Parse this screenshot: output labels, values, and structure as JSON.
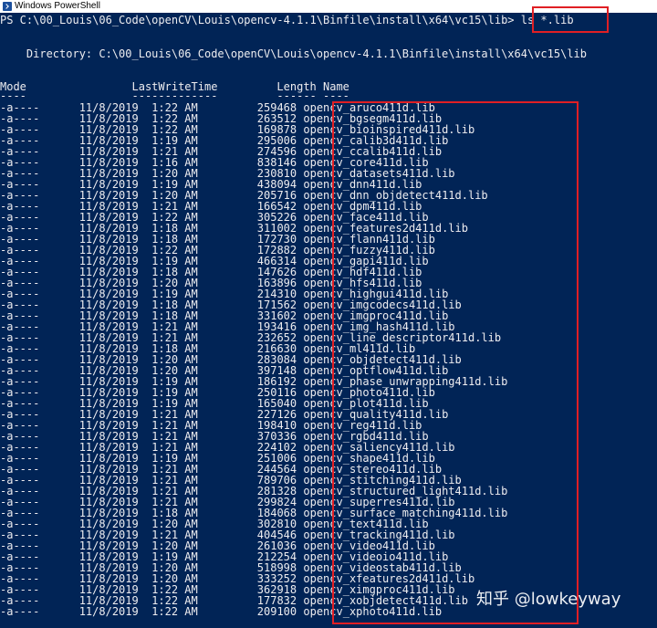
{
  "window": {
    "title": "Windows PowerShell"
  },
  "prompt": {
    "path": "PS C:\\00_Louis\\06_Code\\openCV\\Louis\\opencv-4.1.1\\Binfile\\install\\x64\\vc15\\lib> ",
    "command": "ls *.lib"
  },
  "directory_line": "    Directory: C:\\00_Louis\\06_Code\\openCV\\Louis\\opencv-4.1.1\\Binfile\\install\\x64\\vc15\\lib",
  "columns": {
    "header": "Mode                LastWriteTime         Length Name",
    "underline": "----                -------------         ------ ----"
  },
  "files": [
    [
      "-a----",
      "11/8/2019",
      " 1:22 AM",
      "259468",
      "opencv_aruco411d.lib"
    ],
    [
      "-a----",
      "11/8/2019",
      " 1:22 AM",
      "263512",
      "opencv_bgsegm411d.lib"
    ],
    [
      "-a----",
      "11/8/2019",
      " 1:22 AM",
      "169878",
      "opencv_bioinspired411d.lib"
    ],
    [
      "-a----",
      "11/8/2019",
      " 1:19 AM",
      "295006",
      "opencv_calib3d411d.lib"
    ],
    [
      "-a----",
      "11/8/2019",
      " 1:21 AM",
      "274596",
      "opencv_ccalib411d.lib"
    ],
    [
      "-a----",
      "11/8/2019",
      " 1:16 AM",
      "838146",
      "opencv_core411d.lib"
    ],
    [
      "-a----",
      "11/8/2019",
      " 1:20 AM",
      "230810",
      "opencv_datasets411d.lib"
    ],
    [
      "-a----",
      "11/8/2019",
      " 1:19 AM",
      "438094",
      "opencv_dnn411d.lib"
    ],
    [
      "-a----",
      "11/8/2019",
      " 1:20 AM",
      "205716",
      "opencv_dnn_objdetect411d.lib"
    ],
    [
      "-a----",
      "11/8/2019",
      " 1:21 AM",
      "166542",
      "opencv_dpm411d.lib"
    ],
    [
      "-a----",
      "11/8/2019",
      " 1:22 AM",
      "305226",
      "opencv_face411d.lib"
    ],
    [
      "-a----",
      "11/8/2019",
      " 1:18 AM",
      "311002",
      "opencv_features2d411d.lib"
    ],
    [
      "-a----",
      "11/8/2019",
      " 1:18 AM",
      "172730",
      "opencv_flann411d.lib"
    ],
    [
      "-a----",
      "11/8/2019",
      " 1:22 AM",
      "172882",
      "opencv_fuzzy411d.lib"
    ],
    [
      "-a----",
      "11/8/2019",
      " 1:19 AM",
      "466314",
      "opencv_gapi411d.lib"
    ],
    [
      "-a----",
      "11/8/2019",
      " 1:18 AM",
      "147626",
      "opencv_hdf411d.lib"
    ],
    [
      "-a----",
      "11/8/2019",
      " 1:20 AM",
      "163896",
      "opencv_hfs411d.lib"
    ],
    [
      "-a----",
      "11/8/2019",
      " 1:19 AM",
      "214310",
      "opencv_highgui411d.lib"
    ],
    [
      "-a----",
      "11/8/2019",
      " 1:18 AM",
      "171562",
      "opencv_imgcodecs411d.lib"
    ],
    [
      "-a----",
      "11/8/2019",
      " 1:18 AM",
      "331602",
      "opencv_imgproc411d.lib"
    ],
    [
      "-a----",
      "11/8/2019",
      " 1:21 AM",
      "193416",
      "opencv_img_hash411d.lib"
    ],
    [
      "-a----",
      "11/8/2019",
      " 1:21 AM",
      "232652",
      "opencv_line_descriptor411d.lib"
    ],
    [
      "-a----",
      "11/8/2019",
      " 1:18 AM",
      "216630",
      "opencv_ml411d.lib"
    ],
    [
      "-a----",
      "11/8/2019",
      " 1:20 AM",
      "283084",
      "opencv_objdetect411d.lib"
    ],
    [
      "-a----",
      "11/8/2019",
      " 1:20 AM",
      "397148",
      "opencv_optflow411d.lib"
    ],
    [
      "-a----",
      "11/8/2019",
      " 1:19 AM",
      "186192",
      "opencv_phase_unwrapping411d.lib"
    ],
    [
      "-a----",
      "11/8/2019",
      " 1:19 AM",
      "250116",
      "opencv_photo411d.lib"
    ],
    [
      "-a----",
      "11/8/2019",
      " 1:19 AM",
      "165040",
      "opencv_plot411d.lib"
    ],
    [
      "-a----",
      "11/8/2019",
      " 1:21 AM",
      "227126",
      "opencv_quality411d.lib"
    ],
    [
      "-a----",
      "11/8/2019",
      " 1:21 AM",
      "198410",
      "opencv_reg411d.lib"
    ],
    [
      "-a----",
      "11/8/2019",
      " 1:21 AM",
      "370336",
      "opencv_rgbd411d.lib"
    ],
    [
      "-a----",
      "11/8/2019",
      " 1:21 AM",
      "224102",
      "opencv_saliency411d.lib"
    ],
    [
      "-a----",
      "11/8/2019",
      " 1:19 AM",
      "251006",
      "opencv_shape411d.lib"
    ],
    [
      "-a----",
      "11/8/2019",
      " 1:21 AM",
      "244564",
      "opencv_stereo411d.lib"
    ],
    [
      "-a----",
      "11/8/2019",
      " 1:21 AM",
      "789706",
      "opencv_stitching411d.lib"
    ],
    [
      "-a----",
      "11/8/2019",
      " 1:21 AM",
      "281328",
      "opencv_structured_light411d.lib"
    ],
    [
      "-a----",
      "11/8/2019",
      " 1:21 AM",
      "299824",
      "opencv_superres411d.lib"
    ],
    [
      "-a----",
      "11/8/2019",
      " 1:18 AM",
      "184068",
      "opencv_surface_matching411d.lib"
    ],
    [
      "-a----",
      "11/8/2019",
      " 1:20 AM",
      "302810",
      "opencv_text411d.lib"
    ],
    [
      "-a----",
      "11/8/2019",
      " 1:21 AM",
      "404546",
      "opencv_tracking411d.lib"
    ],
    [
      "-a----",
      "11/8/2019",
      " 1:20 AM",
      "261036",
      "opencv_video411d.lib"
    ],
    [
      "-a----",
      "11/8/2019",
      " 1:19 AM",
      "212254",
      "opencv_videoio411d.lib"
    ],
    [
      "-a----",
      "11/8/2019",
      " 1:20 AM",
      "518998",
      "opencv_videostab411d.lib"
    ],
    [
      "-a----",
      "11/8/2019",
      " 1:20 AM",
      "333252",
      "opencv_xfeatures2d411d.lib"
    ],
    [
      "-a----",
      "11/8/2019",
      " 1:22 AM",
      "362918",
      "opencv_ximgproc411d.lib"
    ],
    [
      "-a----",
      "11/8/2019",
      " 1:22 AM",
      "177832",
      "opencv_xobjdetect411d.lib"
    ],
    [
      "-a----",
      "11/8/2019",
      " 1:22 AM",
      "209100",
      "opencv_xphoto411d.lib"
    ]
  ],
  "watermark": "知乎 @lowkeyway",
  "colors": {
    "background": "#012456",
    "foreground": "#eeedf0",
    "highlight": "#e01f24"
  }
}
